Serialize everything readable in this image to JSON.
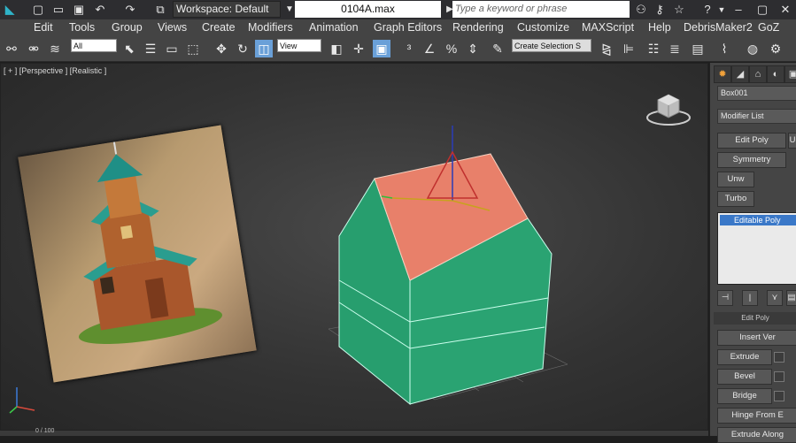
{
  "titlebar": {
    "workspace_label": "Workspace: Default",
    "filename": "0104A.max",
    "search_placeholder": "Type a keyword or phrase"
  },
  "menu": [
    "Edit",
    "Tools",
    "Group",
    "Views",
    "Create",
    "Modifiers",
    "Animation",
    "Graph Editors",
    "Rendering",
    "Customize",
    "MAXScript",
    "Help",
    "DebrisMaker2",
    "GoZ"
  ],
  "toolbar": {
    "filter_value": "All",
    "ref_coord_value": "View",
    "selection_set_value": "Create Selection S"
  },
  "viewport": {
    "label": "[ + ] [Perspective ] [Realistic ]",
    "timeline_counter": "0 / 100"
  },
  "command_panel": {
    "object_name": "Box001",
    "modifier_list_label": "Modifier List",
    "buttons": {
      "edit_poly": "Edit Poly",
      "u_partial": "U",
      "symmetry": "Symmetry",
      "unwrap": "Unw",
      "turbosmooth": "Turbo"
    },
    "stack_item": "Editable Poly",
    "section_title": "Edit Poly",
    "insert_vertex": "Insert Ver",
    "extrude": "Extrude",
    "bevel": "Bevel",
    "bridge": "Bridge",
    "hinge": "Hinge From E",
    "extrude_along": "Extrude Along"
  },
  "colors": {
    "box_green": "#2a9d6f",
    "top_face": "#e87a63",
    "selection_blue": "#3a78c8"
  }
}
